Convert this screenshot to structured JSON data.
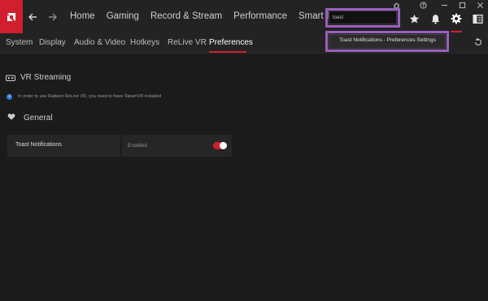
{
  "app": {
    "logo_label": "AMD Radeon Software"
  },
  "nav": {
    "back_icon": "arrow-left-icon",
    "forward_icon": "arrow-right-icon",
    "items": [
      "Home",
      "Gaming",
      "Record & Stream",
      "Performance",
      "Smart Technology"
    ]
  },
  "window_controls": {
    "icons": [
      "bug-report-icon",
      "help-icon",
      "minimize-icon",
      "maximize-icon",
      "close-icon"
    ]
  },
  "search": {
    "value": "toast",
    "suggestion": "Toast Notifications - Preferences Settings"
  },
  "toolbar": {
    "icons": [
      "star-icon",
      "bell-icon",
      "gear-icon",
      "layout-icon"
    ]
  },
  "subnav": {
    "tabs": [
      "System",
      "Display",
      "Audio & Video",
      "Hotkeys",
      "ReLive VR",
      "Preferences"
    ],
    "active": "Preferences",
    "reset_icon": "reset-icon"
  },
  "vr_section": {
    "title": "VR Streaming",
    "info": "In order to use Radeon ReLive VR, you need to have SteamVR installed"
  },
  "general_section": {
    "title": "General",
    "settings": [
      {
        "label": "Toast Notifications",
        "value": "Enabled",
        "enabled": true
      }
    ]
  },
  "colors": {
    "accent": "#d01f2f",
    "highlight": "#9b5fc0",
    "background": "#1b1b1c",
    "bar": "#232324",
    "info": "#2f7fd8"
  }
}
